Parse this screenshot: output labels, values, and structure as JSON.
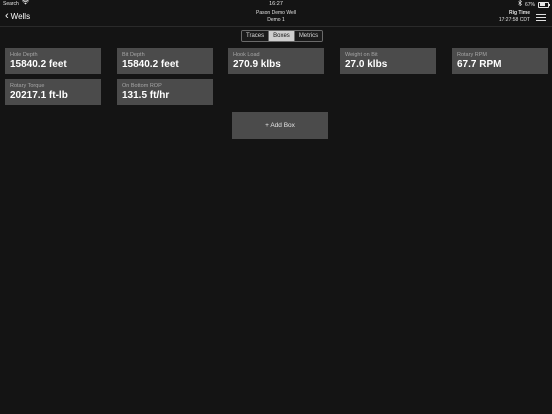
{
  "status_bar": {
    "left_label": "Search",
    "time": "16:27",
    "battery": "67%",
    "battery_level": 0.67
  },
  "nav": {
    "back_label": "Wells",
    "title_line1": "Pason Demo Well",
    "title_line2": "Demo 1",
    "rig_time_label": "Rig Time",
    "rig_time_value": "17:27:58 CDT"
  },
  "tabs": [
    {
      "label": "Traces",
      "active": false
    },
    {
      "label": "Boxes",
      "active": true
    },
    {
      "label": "Metrics",
      "active": false
    }
  ],
  "boxes": [
    {
      "label": "Hole Depth",
      "value": "15840.2 feet"
    },
    {
      "label": "Bit Depth",
      "value": "15840.2 feet"
    },
    {
      "label": "Hook Load",
      "value": "270.9 klbs"
    },
    {
      "label": "Weight on Bit",
      "value": "27.0 klbs"
    },
    {
      "label": "Rotary RPM",
      "value": "67.7 RPM"
    },
    {
      "label": "Rotary Torque",
      "value": "20217.1 ft-lb"
    },
    {
      "label": "On Bottom ROP",
      "value": "131.5 ft/hr"
    }
  ],
  "add_box_label": "+ Add Box",
  "colors": {
    "background": "#141414",
    "box": "#4b4b4b",
    "active_tab": "#cfcfcf"
  }
}
